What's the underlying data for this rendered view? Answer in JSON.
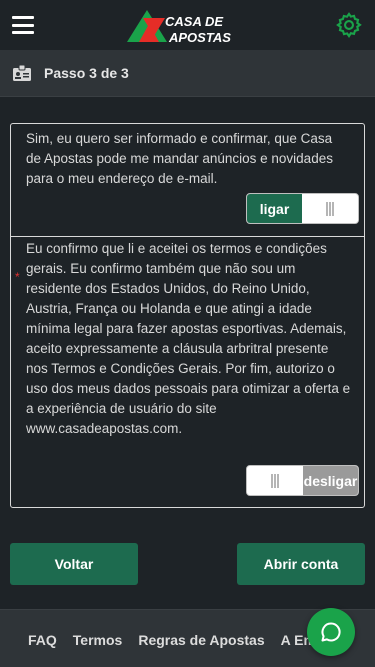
{
  "header": {
    "logo_line1": "CASA DE",
    "logo_line2": "APOSTAS"
  },
  "step": {
    "label": "Passo 3 de 3"
  },
  "consent_marketing": {
    "text": "Sim, eu quero ser informado e confirmar, que Casa de Apostas pode me mandar anúncios e novidades para o meu endereço de e-mail.",
    "toggle_label": "ligar",
    "state": "on"
  },
  "consent_terms": {
    "required_marker": "*",
    "text": "Eu confirmo que li e aceitei os termos e condições gerais. Eu confirmo também que não sou um residente dos Estados Unidos, do Reino Unido, Austria, França ou Holanda e que atingi a idade mínima legal para fazer apostas esportivas. Ademais, aceito expressamente a cláusula arbritral presente nos Termos e Condições Gerais. Por fim, autorizo o uso dos meus dados pessoais para otimizar a oferta e a experiência de usuário do site www.casadeapostas.com.",
    "toggle_label": "desligar",
    "state": "off"
  },
  "buttons": {
    "back": "Voltar",
    "open_account": "Abrir conta"
  },
  "footer": {
    "links": [
      "FAQ",
      "Termos",
      "Regras de Apostas",
      "A Emp"
    ]
  },
  "colors": {
    "accent_green": "#1d6b4f",
    "logo_red": "#e52d27",
    "gear_green": "#1aa34a",
    "chat_green": "#1aa34a"
  }
}
